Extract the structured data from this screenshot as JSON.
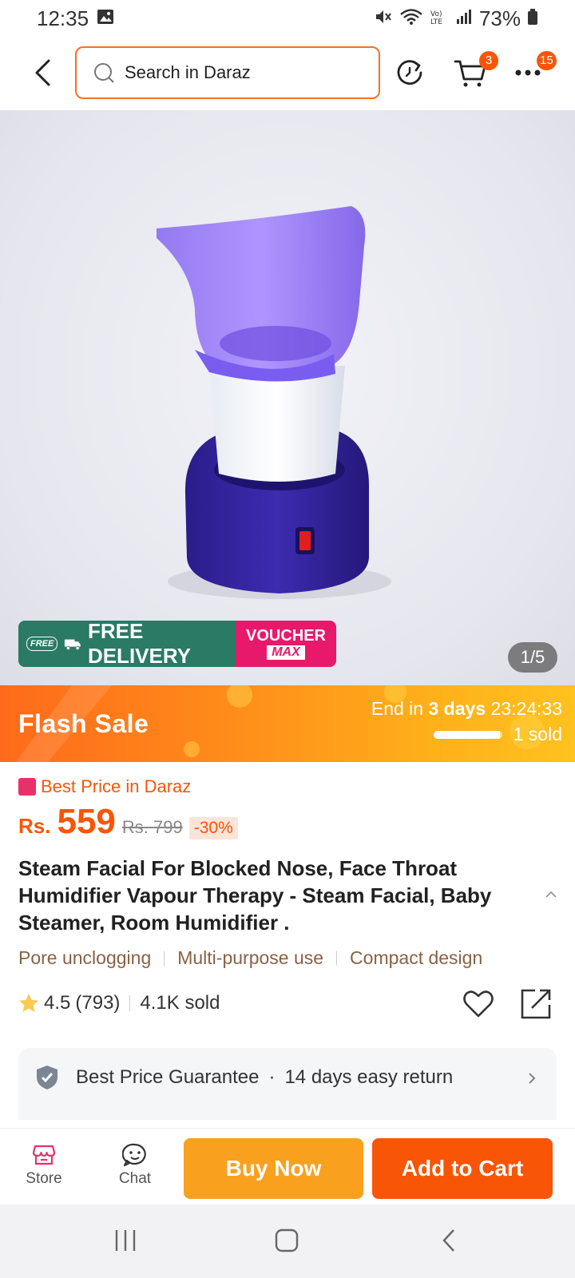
{
  "status_bar": {
    "time": "12:35",
    "battery": "73%"
  },
  "search": {
    "placeholder": "Search in Daraz"
  },
  "nav": {
    "cart_badge": "3",
    "more_badge": "15"
  },
  "promo": {
    "free_tag": "FREE",
    "free_delivery": "FREE DELIVERY",
    "voucher": "VOUCHER",
    "voucher_max": "MAX"
  },
  "image_counter": "1/5",
  "flash_sale": {
    "title": "Flash Sale",
    "end_prefix": "End in",
    "end_days": "3 days",
    "end_time": "23:24:33",
    "sold": "1 sold",
    "progress": 0.97
  },
  "product": {
    "best_price": "Best Price in Daraz",
    "currency": "Rs.",
    "price": "559",
    "old_price": "Rs. 799",
    "discount": "-30%",
    "title": "Steam Facial For Blocked Nose, Face Throat Humidifier Vapour Therapy - Steam Facial, Baby Steamer, Room Humidifier .",
    "tags": [
      "Pore unclogging",
      "Multi-purpose use",
      "Compact design"
    ],
    "rating": "4.5",
    "reviews": "(793)",
    "sold": "4.1K sold"
  },
  "guarantee": {
    "text1": "Best Price Guarantee",
    "text2": "14 days easy return"
  },
  "bottom": {
    "store": "Store",
    "chat": "Chat",
    "buy_now": "Buy Now",
    "add_to_cart": "Add to Cart"
  },
  "colors": {
    "accent": "#f85606",
    "buy_now": "#f9a11f",
    "free_delivery": "#2a7a66",
    "voucher": "#e8196b"
  }
}
